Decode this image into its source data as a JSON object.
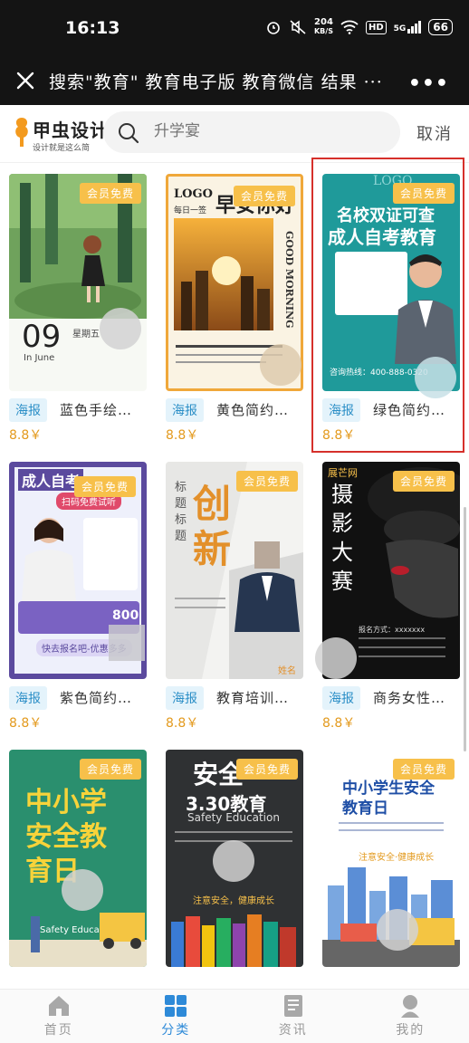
{
  "status_bar": {
    "time": "16:13",
    "net_speed_value": "204",
    "net_speed_unit": "KB/S",
    "hd_label": "HD",
    "signal_label": "5G",
    "battery": "66"
  },
  "title_bar": {
    "title": "搜索\"教育\" 教育电子版 教育微信 结果 ···",
    "more_label": "•••"
  },
  "header": {
    "logo_text": "甲虫设计",
    "logo_sub": "设计就是这么简",
    "search_placeholder": "升学宴",
    "cancel_label": "取消"
  },
  "badge_label": "会员免费",
  "cards": [
    {
      "tag": "海报",
      "title": "蓝色手绘…",
      "price": "8.8￥",
      "poster": {
        "date": "09",
        "month": "In June",
        "week": "星期五"
      }
    },
    {
      "tag": "海报",
      "title": "黄色简约…",
      "price": "8.8￥",
      "poster": {
        "logo": "LOGO",
        "headline": "早安你好",
        "sub": "每日一签",
        "side": "GOOD MORNING"
      }
    },
    {
      "tag": "海报",
      "title": "绿色简约…",
      "price": "8.8￥",
      "poster": {
        "top": "LOGO",
        "headline1": "名校双证可查",
        "headline2": "成人自考教育",
        "phone": "咨询热线：400-888-0320"
      }
    },
    {
      "tag": "海报",
      "title": "紫色简约…",
      "price": "8.8￥",
      "poster": {
        "headline": "成人自考",
        "button": "扫码免费试听",
        "price": "800",
        "cta": "快去报名吧-优惠多多"
      }
    },
    {
      "tag": "海报",
      "title": "教育培训…",
      "price": "8.8￥",
      "poster": {
        "label": "标题标题",
        "headline": "创新",
        "name": "姓名"
      }
    },
    {
      "tag": "海报",
      "title": "商务女性…",
      "price": "8.8￥",
      "poster": {
        "brand": "展芒网",
        "headline": "摄影大赛",
        "info": "报名方式：xxxxxxx"
      }
    },
    {
      "tag": "海报",
      "title": "",
      "price": "",
      "poster": {
        "headline": "中小学安全教育日",
        "sub": "Safety Education"
      }
    },
    {
      "tag": "海报",
      "title": "",
      "price": "",
      "poster": {
        "headline": "安全",
        "date": "3.30教育",
        "sub": "Safety Education",
        "slogan": "注意安全，健康成长"
      }
    },
    {
      "tag": "海报",
      "title": "",
      "price": "",
      "poster": {
        "headline": "中小学生安全教育日",
        "slogan": "注意安全·健康成长"
      }
    }
  ],
  "bottom_nav": [
    {
      "label": "首页",
      "icon": "home-icon"
    },
    {
      "label": "分类",
      "icon": "grid-icon"
    },
    {
      "label": "资讯",
      "icon": "news-icon"
    },
    {
      "label": "我的",
      "icon": "profile-icon"
    }
  ],
  "colors": {
    "accent": "#2e8ad8",
    "badge": "#f7c04a",
    "price": "#e39a1e",
    "tag_bg": "#e4f3fb",
    "selected_border": "#d6302b"
  }
}
